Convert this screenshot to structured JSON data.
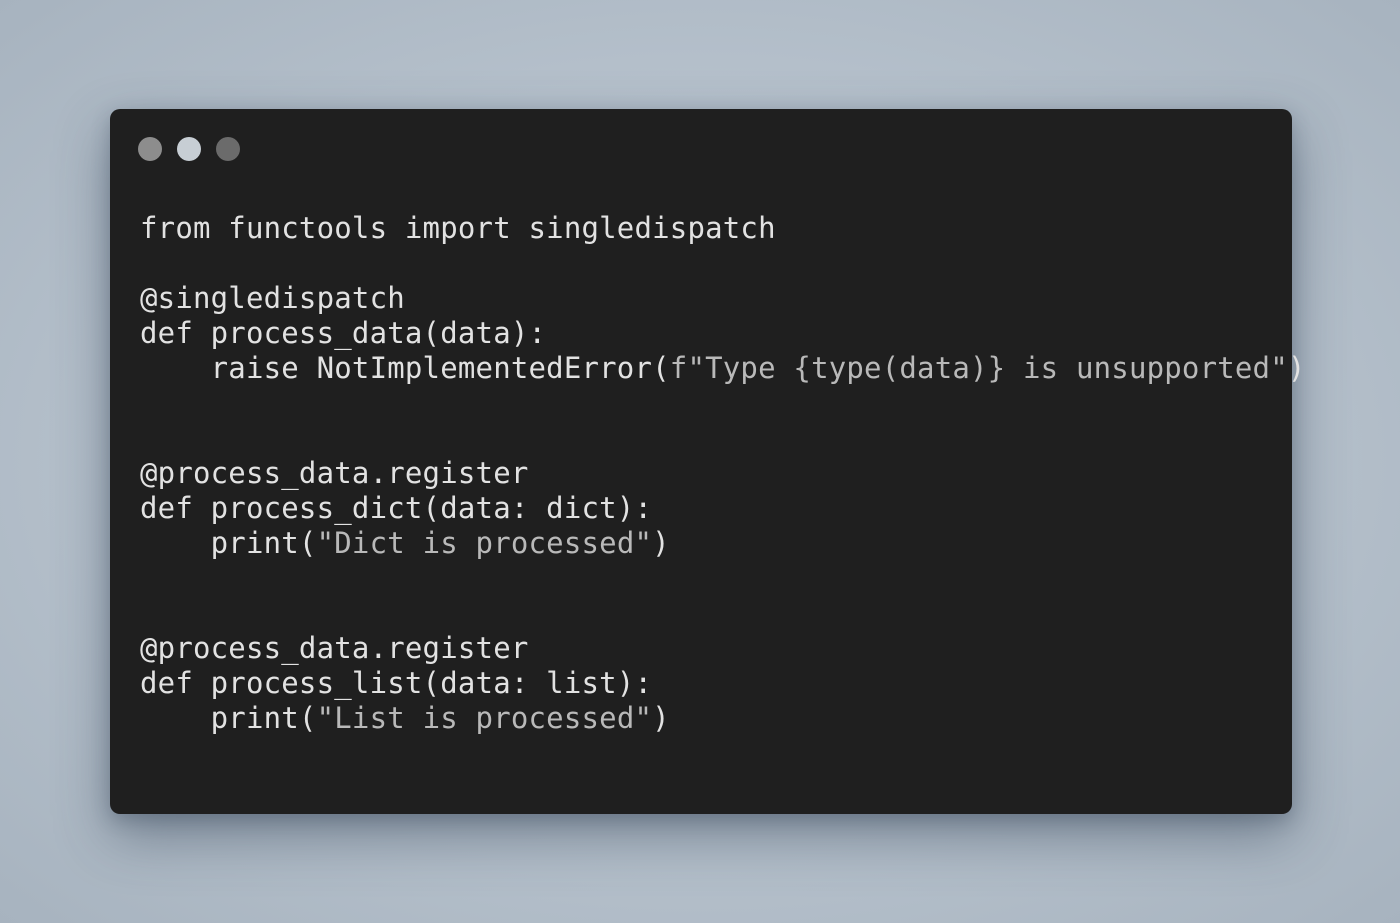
{
  "window": {
    "buttons": [
      {
        "name": "close",
        "color": "#8d8d8d"
      },
      {
        "name": "minimize",
        "color": "#c7ced4"
      },
      {
        "name": "maximize",
        "color": "#6b6b6b"
      }
    ]
  },
  "code": {
    "language": "python",
    "lines": [
      {
        "code": "from functools import singledispatch",
        "str": ""
      },
      {
        "code": "",
        "str": ""
      },
      {
        "code": "@singledispatch",
        "str": ""
      },
      {
        "code": "def process_data(data):",
        "str": ""
      },
      {
        "code": "    raise NotImplementedError(",
        "str": "f\"Type {type(data)} is unsupported\"",
        "tail": ")"
      },
      {
        "code": "",
        "str": ""
      },
      {
        "code": "",
        "str": ""
      },
      {
        "code": "@process_data.register",
        "str": ""
      },
      {
        "code": "def process_dict(data: dict):",
        "str": ""
      },
      {
        "code": "    print(",
        "str": "\"Dict is processed\"",
        "tail": ")"
      },
      {
        "code": "",
        "str": ""
      },
      {
        "code": "",
        "str": ""
      },
      {
        "code": "@process_data.register",
        "str": ""
      },
      {
        "code": "def process_list(data: list):",
        "str": ""
      },
      {
        "code": "    print(",
        "str": "\"List is processed\"",
        "tail": ")"
      }
    ]
  },
  "colors": {
    "background": "#b6c1cc",
    "window": "#1f1f1f",
    "code_text": "#e2e2e2",
    "string_text": "#b9b9b9"
  }
}
